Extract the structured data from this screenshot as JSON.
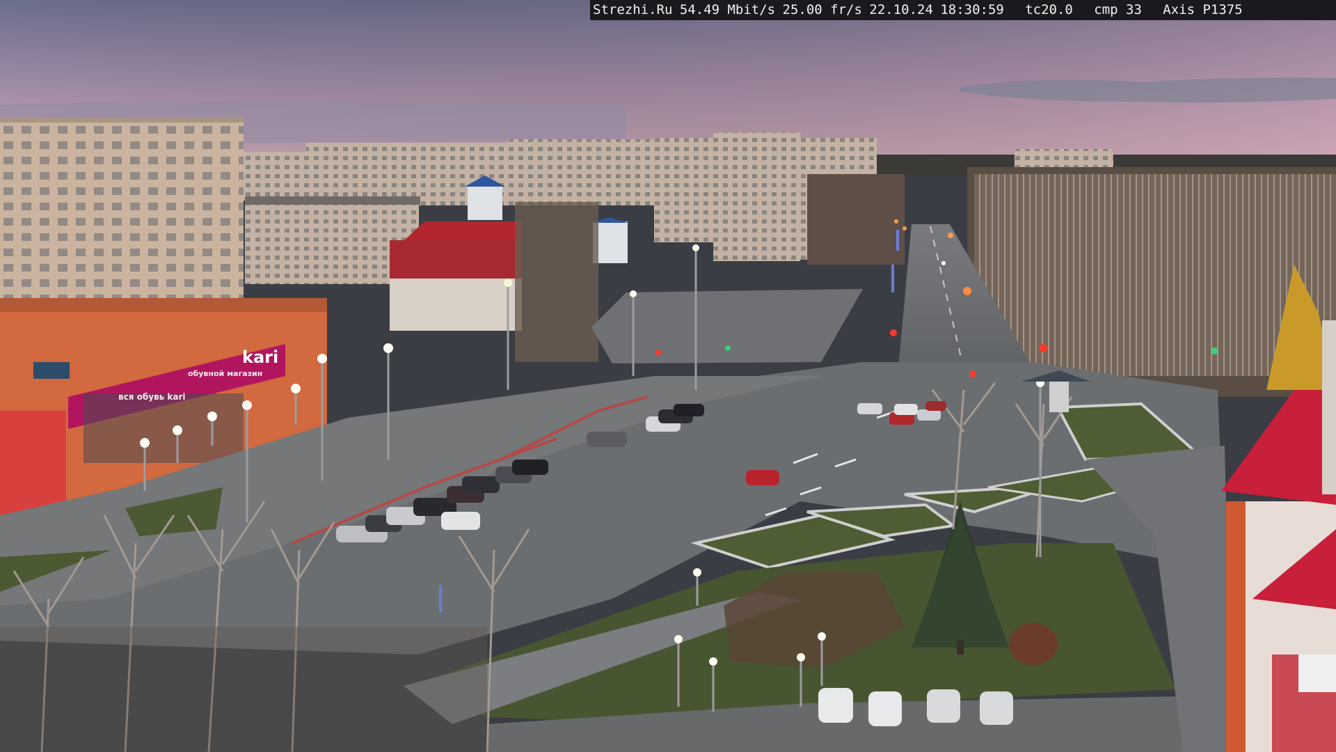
{
  "overlay": {
    "site": "Strezhi.Ru",
    "bitrate": "54.49 Mbit/s",
    "fps": "25.00 fr/s",
    "date": "22.10.24",
    "time": "18:30:59",
    "tc": "tc20.0",
    "cmp": "cmp 33",
    "camera": "Axis P1375"
  },
  "signs": {
    "store_logo": "kari",
    "store_banner": "обувной магазин",
    "store_banner_lower": "вся обувь kari",
    "left_sign": "",
    "pharmacy_sign": ""
  },
  "colors": {
    "sky_top": "#6e6f8e",
    "sky_horizon": "#c7a3b4",
    "road": "#6d7073",
    "grass": "#5d6a3a",
    "building_beige": "#c9b4a0",
    "store_orange": "#d96a3e",
    "kari_magenta": "#b0155e",
    "red_roof": "#b3262e"
  }
}
